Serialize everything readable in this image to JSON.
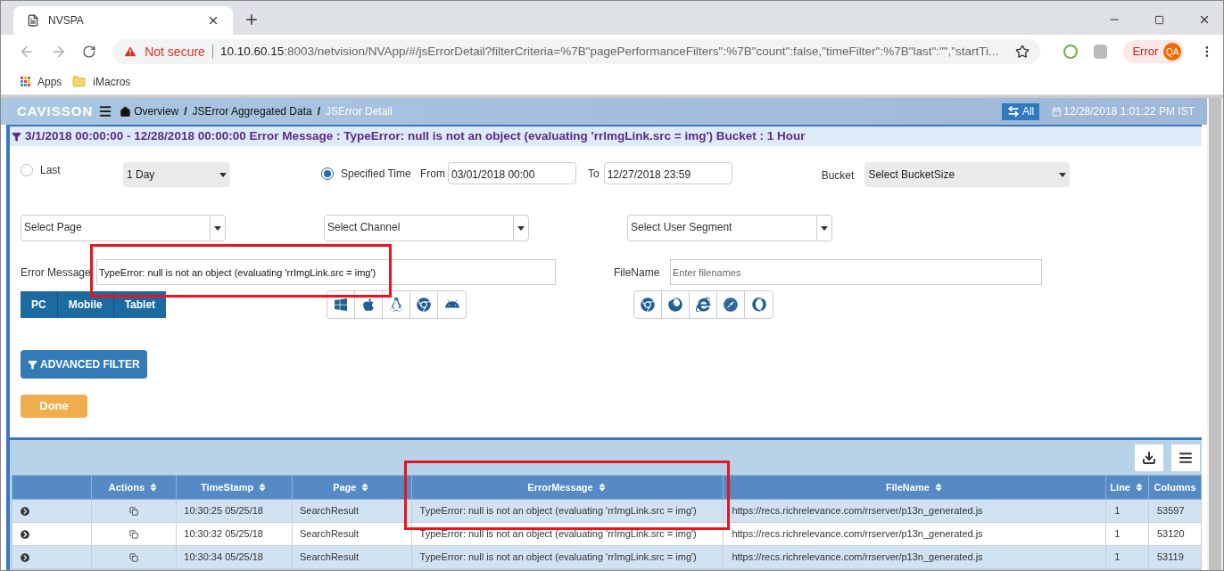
{
  "browser": {
    "tab_title": "NVSPA",
    "security": "Not secure",
    "url_host": "10.10.60.15",
    "url_rest": ":8003/netvision/NVApp/#/jsErrorDetail?filterCriteria=%7B\"pagePerformanceFilters\":%7B\"count\":false,\"timeFilter\":%7B\"last\":\"\",\"startTi...",
    "profile_status": "Error",
    "profile_initials": "QA",
    "bookmarks": [
      "Apps",
      "iMacros"
    ]
  },
  "header": {
    "logo": "CAVISSON",
    "breadcrumb": [
      {
        "label": "Overview",
        "current": false,
        "separator": "/"
      },
      {
        "label": "JSError Aggregated Data",
        "current": false,
        "separator": "/"
      },
      {
        "label": "JSError Detail",
        "current": true
      }
    ],
    "all_button": "All",
    "datetime": "12/28/2018 1:01:22 PM IST"
  },
  "filter_summary": "3/1/2018 00:00:00 - 12/28/2018 00:00:00 Error Message : TypeError: null is not an object (evaluating 'rrImgLink.src = img') Bucket : 1 Hour",
  "form": {
    "time_options": [
      {
        "label": "Last",
        "selected": false
      },
      {
        "label": "Specified Time",
        "selected": true
      }
    ],
    "last_select": "1 Day",
    "from_label": "From",
    "from_value": "03/01/2018 00:00",
    "to_label": "To",
    "to_value": "12/27/2018 23:59",
    "bucket_label": "Bucket",
    "bucket_select": "Select BucketSize",
    "selects": [
      "Select Page",
      "Select Channel",
      "Select User Segment"
    ],
    "error_message": {
      "label": "Error Message",
      "value": "TypeError: null is not an object (evaluating 'rrImgLink.src = img')",
      "highlighted": true
    },
    "filename": {
      "label": "FileName",
      "placeholder": "Enter filenames"
    },
    "device_tabs": [
      "PC",
      "Mobile",
      "Tablet"
    ],
    "advanced_filter": "ADVANCED FILTER",
    "done": "Done"
  },
  "table": {
    "columns": [
      {
        "sortable": false,
        "highlighted": false
      },
      {
        "label": "Actions",
        "sortable": true,
        "highlighted": false
      },
      {
        "label": "TimeStamp",
        "sortable": true,
        "highlighted": false
      },
      {
        "label": "Page",
        "sortable": true,
        "highlighted": false
      },
      {
        "label": "ErrorMessage",
        "sortable": true,
        "highlighted": true
      },
      {
        "label": "FileName",
        "sortable": true,
        "highlighted": false
      },
      {
        "label": "Line",
        "sortable": true,
        "highlighted": false
      },
      {
        "label": "Columns",
        "sortable": false,
        "highlighted": false
      }
    ],
    "rows": [
      {
        "cells": [
          "",
          "",
          "10:30:25 05/25/18",
          "SearchResult",
          "TypeError: null is not an object (evaluating 'rrImgLink.src = img')",
          "https://recs.richrelevance.com/rrserver/p13n_generated.js",
          "1",
          "53597"
        ]
      },
      {
        "cells": [
          "",
          "",
          "10:30:32 05/25/18",
          "SearchResult",
          "TypeError: null is not an object (evaluating 'rrImgLink.src = img')",
          "https://recs.richrelevance.com/rrserver/p13n_generated.js",
          "1",
          "53120"
        ]
      },
      {
        "cells": [
          "",
          "",
          "10:30:34 05/25/18",
          "SearchResult",
          "TypeError: null is not an object (evaluating 'rrImgLink.src = img')",
          "https://recs.richrelevance.com/rrserver/p13n_generated.js",
          "1",
          "53119"
        ]
      }
    ]
  }
}
